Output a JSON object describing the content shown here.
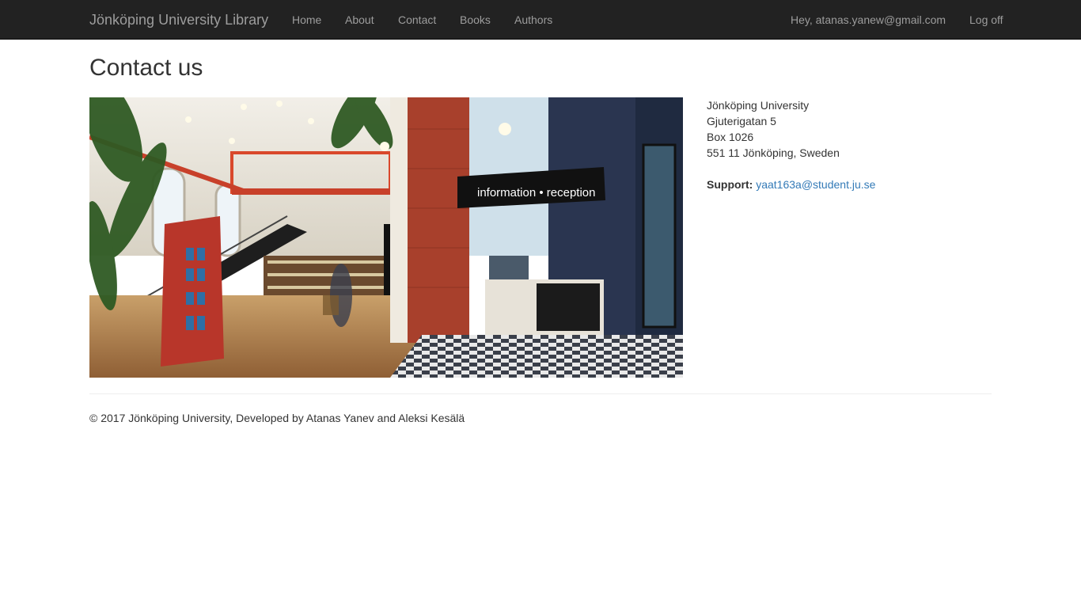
{
  "nav": {
    "brand": "Jönköping University Library",
    "links": [
      "Home",
      "About",
      "Contact",
      "Books",
      "Authors"
    ],
    "greeting": "Hey, atanas.yanew@gmail.com",
    "logoff": "Log off"
  },
  "page": {
    "title": "Contact us"
  },
  "photo": {
    "sign_text": "information • reception",
    "accent_colors": {
      "brick": "#a8402c",
      "dark_blue": "#2a3550",
      "shelf_red": "#c0392b",
      "floor": "#b08050"
    }
  },
  "address": {
    "lines": [
      "Jönköping University",
      "Gjuterigatan 5",
      "Box 1026",
      "551 11 Jönköping, Sweden"
    ]
  },
  "support": {
    "label": "Support:",
    "email": "yaat163a@student.ju.se"
  },
  "footer": {
    "text": "© 2017 Jönköping University, Developed by Atanas Yanev and Aleksi Kesälä"
  },
  "colors": {
    "navbar_bg": "#222222",
    "nav_text": "#9d9d9d",
    "link": "#337ab7",
    "text": "#333333"
  }
}
